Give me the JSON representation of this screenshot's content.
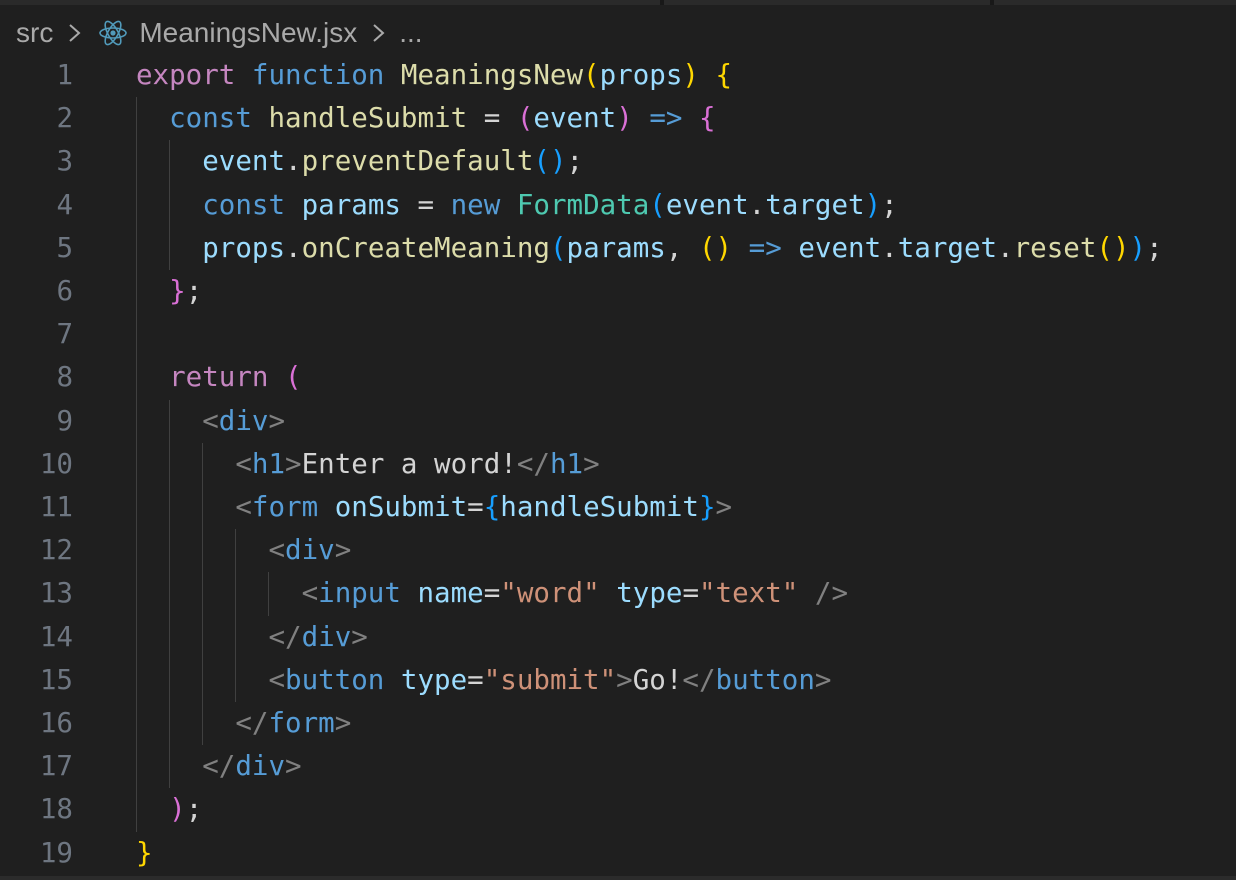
{
  "breadcrumb": {
    "items": [
      "src",
      "MeaningsNew.jsx",
      "..."
    ]
  },
  "editor": {
    "language": "jsx",
    "lines": [
      {
        "n": "1",
        "tokens": [
          {
            "t": "export",
            "c": "kw-c"
          },
          {
            "t": " ",
            "c": "txt"
          },
          {
            "t": "function",
            "c": "kw-s"
          },
          {
            "t": " ",
            "c": "txt"
          },
          {
            "t": "MeaningsNew",
            "c": "fn"
          },
          {
            "t": "(",
            "c": "b1"
          },
          {
            "t": "props",
            "c": "var"
          },
          {
            "t": ")",
            "c": "b1"
          },
          {
            "t": " ",
            "c": "txt"
          },
          {
            "t": "{",
            "c": "b1"
          }
        ]
      },
      {
        "n": "2",
        "tokens": [
          {
            "t": "  ",
            "c": "txt"
          },
          {
            "t": "const",
            "c": "kw-s"
          },
          {
            "t": " ",
            "c": "txt"
          },
          {
            "t": "handleSubmit",
            "c": "fn"
          },
          {
            "t": " = ",
            "c": "op"
          },
          {
            "t": "(",
            "c": "b2"
          },
          {
            "t": "event",
            "c": "var"
          },
          {
            "t": ")",
            "c": "b2"
          },
          {
            "t": " ",
            "c": "txt"
          },
          {
            "t": "=>",
            "c": "arrow"
          },
          {
            "t": " ",
            "c": "txt"
          },
          {
            "t": "{",
            "c": "b2"
          }
        ]
      },
      {
        "n": "3",
        "tokens": [
          {
            "t": "    ",
            "c": "txt"
          },
          {
            "t": "event",
            "c": "var"
          },
          {
            "t": ".",
            "c": "op"
          },
          {
            "t": "preventDefault",
            "c": "fn"
          },
          {
            "t": "(",
            "c": "b3"
          },
          {
            "t": ")",
            "c": "b3"
          },
          {
            "t": ";",
            "c": "op"
          }
        ]
      },
      {
        "n": "4",
        "tokens": [
          {
            "t": "    ",
            "c": "txt"
          },
          {
            "t": "const",
            "c": "kw-s"
          },
          {
            "t": " ",
            "c": "txt"
          },
          {
            "t": "params",
            "c": "var"
          },
          {
            "t": " = ",
            "c": "op"
          },
          {
            "t": "new",
            "c": "kw-s"
          },
          {
            "t": " ",
            "c": "txt"
          },
          {
            "t": "FormData",
            "c": "cls"
          },
          {
            "t": "(",
            "c": "b3"
          },
          {
            "t": "event",
            "c": "var"
          },
          {
            "t": ".",
            "c": "op"
          },
          {
            "t": "target",
            "c": "var"
          },
          {
            "t": ")",
            "c": "b3"
          },
          {
            "t": ";",
            "c": "op"
          }
        ]
      },
      {
        "n": "5",
        "tokens": [
          {
            "t": "    ",
            "c": "txt"
          },
          {
            "t": "props",
            "c": "var"
          },
          {
            "t": ".",
            "c": "op"
          },
          {
            "t": "onCreateMeaning",
            "c": "fn"
          },
          {
            "t": "(",
            "c": "b3"
          },
          {
            "t": "params",
            "c": "var"
          },
          {
            "t": ", ",
            "c": "op"
          },
          {
            "t": "(",
            "c": "b1"
          },
          {
            "t": ")",
            "c": "b1"
          },
          {
            "t": " ",
            "c": "txt"
          },
          {
            "t": "=>",
            "c": "arrow"
          },
          {
            "t": " ",
            "c": "txt"
          },
          {
            "t": "event",
            "c": "var"
          },
          {
            "t": ".",
            "c": "op"
          },
          {
            "t": "target",
            "c": "var"
          },
          {
            "t": ".",
            "c": "op"
          },
          {
            "t": "reset",
            "c": "fn"
          },
          {
            "t": "(",
            "c": "b1"
          },
          {
            "t": ")",
            "c": "b1"
          },
          {
            "t": ")",
            "c": "b3"
          },
          {
            "t": ";",
            "c": "op"
          }
        ]
      },
      {
        "n": "6",
        "tokens": [
          {
            "t": "  ",
            "c": "txt"
          },
          {
            "t": "}",
            "c": "b2"
          },
          {
            "t": ";",
            "c": "op"
          }
        ]
      },
      {
        "n": "7",
        "tokens": []
      },
      {
        "n": "8",
        "tokens": [
          {
            "t": "  ",
            "c": "txt"
          },
          {
            "t": "return",
            "c": "kw-c"
          },
          {
            "t": " ",
            "c": "txt"
          },
          {
            "t": "(",
            "c": "b2"
          }
        ]
      },
      {
        "n": "9",
        "tokens": [
          {
            "t": "    ",
            "c": "txt"
          },
          {
            "t": "<",
            "c": "punc"
          },
          {
            "t": "div",
            "c": "tag"
          },
          {
            "t": ">",
            "c": "punc"
          }
        ]
      },
      {
        "n": "10",
        "tokens": [
          {
            "t": "      ",
            "c": "txt"
          },
          {
            "t": "<",
            "c": "punc"
          },
          {
            "t": "h1",
            "c": "tag"
          },
          {
            "t": ">",
            "c": "punc"
          },
          {
            "t": "Enter a word!",
            "c": "txt"
          },
          {
            "t": "</",
            "c": "punc"
          },
          {
            "t": "h1",
            "c": "tag"
          },
          {
            "t": ">",
            "c": "punc"
          }
        ]
      },
      {
        "n": "11",
        "tokens": [
          {
            "t": "      ",
            "c": "txt"
          },
          {
            "t": "<",
            "c": "punc"
          },
          {
            "t": "form",
            "c": "tag"
          },
          {
            "t": " ",
            "c": "txt"
          },
          {
            "t": "onSubmit",
            "c": "var"
          },
          {
            "t": "=",
            "c": "op"
          },
          {
            "t": "{",
            "c": "b3"
          },
          {
            "t": "handleSubmit",
            "c": "var"
          },
          {
            "t": "}",
            "c": "b3"
          },
          {
            "t": ">",
            "c": "punc"
          }
        ]
      },
      {
        "n": "12",
        "tokens": [
          {
            "t": "        ",
            "c": "txt"
          },
          {
            "t": "<",
            "c": "punc"
          },
          {
            "t": "div",
            "c": "tag"
          },
          {
            "t": ">",
            "c": "punc"
          }
        ]
      },
      {
        "n": "13",
        "tokens": [
          {
            "t": "          ",
            "c": "txt"
          },
          {
            "t": "<",
            "c": "punc"
          },
          {
            "t": "input",
            "c": "tag"
          },
          {
            "t": " ",
            "c": "txt"
          },
          {
            "t": "name",
            "c": "var"
          },
          {
            "t": "=",
            "c": "op"
          },
          {
            "t": "\"word\"",
            "c": "str"
          },
          {
            "t": " ",
            "c": "txt"
          },
          {
            "t": "type",
            "c": "var"
          },
          {
            "t": "=",
            "c": "op"
          },
          {
            "t": "\"text\"",
            "c": "str"
          },
          {
            "t": " ",
            "c": "txt"
          },
          {
            "t": "/>",
            "c": "punc"
          }
        ]
      },
      {
        "n": "14",
        "tokens": [
          {
            "t": "        ",
            "c": "txt"
          },
          {
            "t": "</",
            "c": "punc"
          },
          {
            "t": "div",
            "c": "tag"
          },
          {
            "t": ">",
            "c": "punc"
          }
        ]
      },
      {
        "n": "15",
        "tokens": [
          {
            "t": "        ",
            "c": "txt"
          },
          {
            "t": "<",
            "c": "punc"
          },
          {
            "t": "button",
            "c": "tag"
          },
          {
            "t": " ",
            "c": "txt"
          },
          {
            "t": "type",
            "c": "var"
          },
          {
            "t": "=",
            "c": "op"
          },
          {
            "t": "\"submit\"",
            "c": "str"
          },
          {
            "t": ">",
            "c": "punc"
          },
          {
            "t": "Go!",
            "c": "txt"
          },
          {
            "t": "</",
            "c": "punc"
          },
          {
            "t": "button",
            "c": "tag"
          },
          {
            "t": ">",
            "c": "punc"
          }
        ]
      },
      {
        "n": "16",
        "tokens": [
          {
            "t": "      ",
            "c": "txt"
          },
          {
            "t": "</",
            "c": "punc"
          },
          {
            "t": "form",
            "c": "tag"
          },
          {
            "t": ">",
            "c": "punc"
          }
        ]
      },
      {
        "n": "17",
        "tokens": [
          {
            "t": "    ",
            "c": "txt"
          },
          {
            "t": "</",
            "c": "punc"
          },
          {
            "t": "div",
            "c": "tag"
          },
          {
            "t": ">",
            "c": "punc"
          }
        ]
      },
      {
        "n": "18",
        "tokens": [
          {
            "t": "  ",
            "c": "txt"
          },
          {
            "t": ")",
            "c": "b2"
          },
          {
            "t": ";",
            "c": "op"
          }
        ]
      },
      {
        "n": "19",
        "tokens": [
          {
            "t": "}",
            "c": "b1"
          }
        ]
      }
    ]
  },
  "icons": {
    "file_type": "react-icon",
    "separator": "chevron-right-icon"
  },
  "colors": {
    "background": "#1f1f1f",
    "line_number": "#6e7681",
    "indent_guide": "#404040"
  }
}
